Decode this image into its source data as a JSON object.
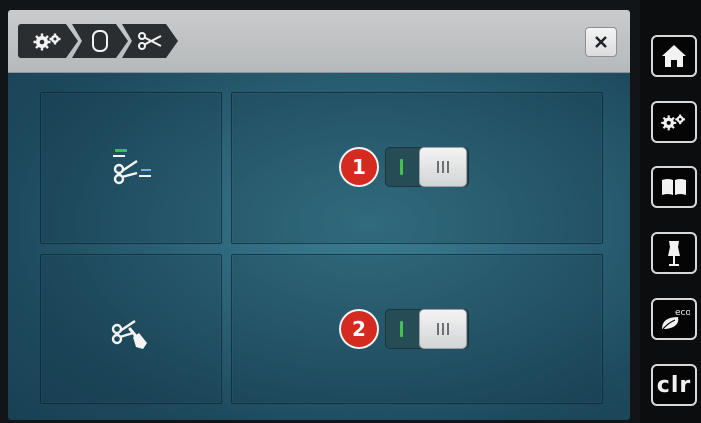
{
  "header": {
    "breadcrumb": [
      {
        "icon": "gears-icon"
      },
      {
        "icon": "embroidery-hoop-icon"
      },
      {
        "icon": "scissors-icon"
      }
    ],
    "close_icon": "close-icon"
  },
  "settings": [
    {
      "icon": "thread-cut-icon",
      "callout": "1",
      "toggle": {
        "on_label": "I",
        "off_label": "III",
        "state": "off"
      }
    },
    {
      "icon": "scissors-touch-icon",
      "callout": "2",
      "toggle": {
        "on_label": "I",
        "off_label": "III",
        "state": "off"
      }
    }
  ],
  "sidebar": {
    "buttons": [
      {
        "icon": "home-icon"
      },
      {
        "icon": "settings-icon"
      },
      {
        "icon": "tutorial-book-icon"
      },
      {
        "icon": "dress-form-icon"
      },
      {
        "icon": "eco-icon",
        "label": "eco"
      },
      {
        "icon": "clear-icon",
        "label": "clr"
      }
    ]
  },
  "colors": {
    "accent_on": "#45c24c",
    "callout_red": "#d42a1f",
    "header_grey": "#c4c6c7"
  }
}
